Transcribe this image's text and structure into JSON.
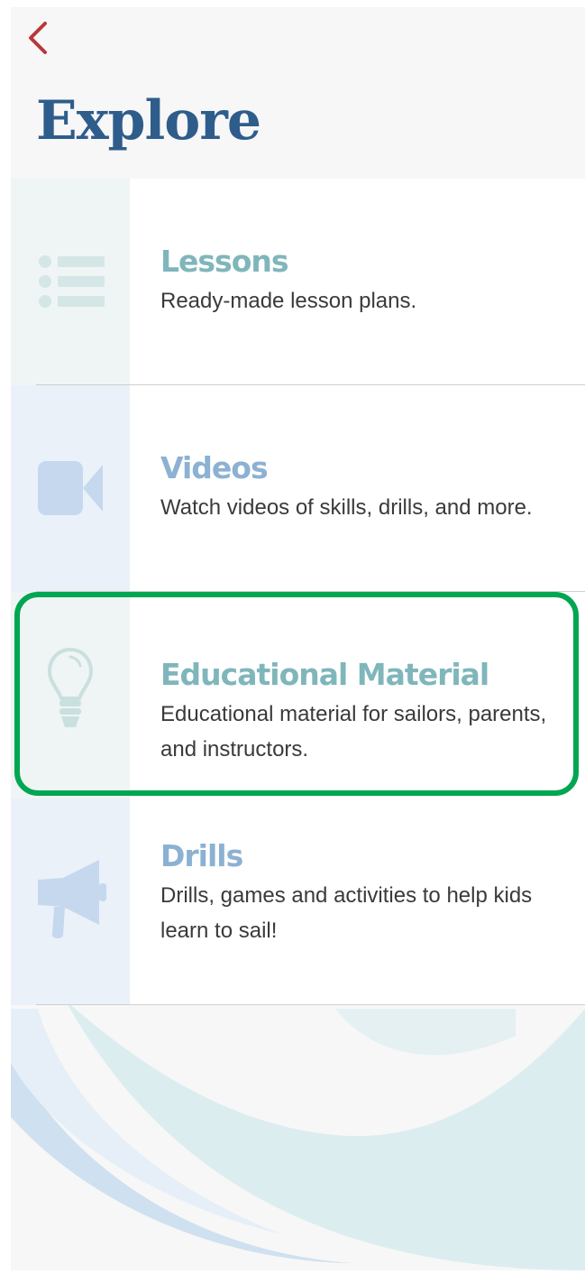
{
  "header": {
    "back_icon": "chevron-left-icon",
    "title": "Explore"
  },
  "menu": [
    {
      "id": "lessons",
      "icon": "list-icon",
      "title": "Lessons",
      "description": "Ready-made lesson plans."
    },
    {
      "id": "videos",
      "icon": "video-camera-icon",
      "title": "Videos",
      "description": "Watch videos of skills, drills, and more."
    },
    {
      "id": "educational-material",
      "icon": "lightbulb-icon",
      "title": "Educational Material",
      "description": "Educational material for sailors, parents, and instructors.",
      "highlighted": true
    },
    {
      "id": "drills",
      "icon": "megaphone-icon",
      "title": "Drills",
      "description": "Drills, games and activities to help kids learn to sail!"
    }
  ],
  "colors": {
    "title": "#2e5d8c",
    "back_arrow": "#b8383a",
    "teal_accent": "#7fb6bb",
    "blue_accent": "#8cb1d2",
    "highlight": "#00a652",
    "background": "#f7f7f7"
  }
}
